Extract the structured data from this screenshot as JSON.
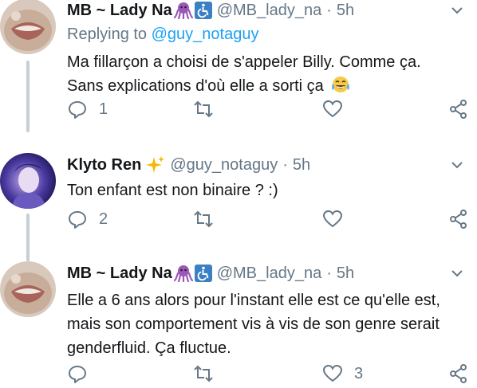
{
  "tweets": [
    {
      "name": "MB ~ Lady Na",
      "handle": "@MB_lady_na",
      "separator": "·",
      "time": "5h",
      "reply_prefix": "Replying to",
      "reply_mention": "@guy_notaguy",
      "lines": [
        "Ma fillarçon a choisi de s'appeler Billy. Comme ça.",
        "Sans explications d'où elle a sorti ça"
      ],
      "emoji_after_text": "😂",
      "name_emojis": [
        "🐙",
        "♿"
      ],
      "reply_count": "1",
      "like_count": ""
    },
    {
      "name": "Klyto Ren",
      "handle": "@guy_notaguy",
      "separator": "·",
      "time": "5h",
      "lines": [
        "Ton enfant est non binaire ? :)"
      ],
      "name_emojis": [
        "✨"
      ],
      "reply_count": "2",
      "like_count": ""
    },
    {
      "name": "MB ~ Lady Na",
      "handle": "@MB_lady_na",
      "separator": "·",
      "time": "5h",
      "lines": [
        "Elle a 6 ans alors pour l'instant elle est ce qu'elle est,",
        "mais son comportement vis à vis de son genre serait",
        "genderfluid. Ça fluctue."
      ],
      "name_emojis": [
        "🐙",
        "♿"
      ],
      "reply_count": "",
      "like_count": "3"
    }
  ],
  "colors": {
    "text": "#14171a",
    "secondary": "#657786",
    "link": "#1da1f2",
    "thread_line": "#c4cfd6",
    "octopus": "#9b59b6",
    "accessibility": "#3b7fc4",
    "sparkle": "#f5b800"
  },
  "icons": [
    "reply-icon",
    "retweet-icon",
    "like-icon",
    "share-icon",
    "chevron-down-icon",
    "octopus-emoji",
    "wheelchair-emoji",
    "sparkles-emoji",
    "tears-of-joy-emoji"
  ]
}
